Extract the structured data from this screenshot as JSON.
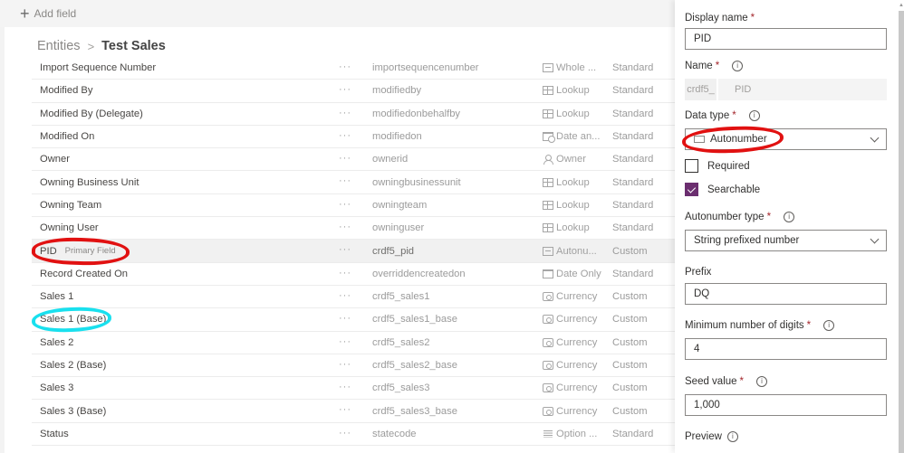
{
  "command_bar": {
    "add_field_icon": "plus-icon",
    "add_field_label": "Add field"
  },
  "breadcrumb": {
    "parent": "Entities",
    "separator": ">",
    "current": "Test Sales"
  },
  "fields_table": {
    "rows": [
      {
        "display_name": "Import Sequence Number",
        "tag": "",
        "schema_name": "importsequencenumber",
        "data_type": "Whole ...",
        "type_icon": "whole-number-icon",
        "customization": "Standard"
      },
      {
        "display_name": "Modified By",
        "tag": "",
        "schema_name": "modifiedby",
        "data_type": "Lookup",
        "type_icon": "lookup-icon",
        "customization": "Standard"
      },
      {
        "display_name": "Modified By (Delegate)",
        "tag": "",
        "schema_name": "modifiedonbehalfby",
        "data_type": "Lookup",
        "type_icon": "lookup-icon",
        "customization": "Standard"
      },
      {
        "display_name": "Modified On",
        "tag": "",
        "schema_name": "modifiedon",
        "data_type": "Date an...",
        "type_icon": "date-time-icon",
        "customization": "Standard"
      },
      {
        "display_name": "Owner",
        "tag": "",
        "schema_name": "ownerid",
        "data_type": "Owner",
        "type_icon": "owner-icon",
        "customization": "Standard"
      },
      {
        "display_name": "Owning Business Unit",
        "tag": "",
        "schema_name": "owningbusinessunit",
        "data_type": "Lookup",
        "type_icon": "lookup-icon",
        "customization": "Standard"
      },
      {
        "display_name": "Owning Team",
        "tag": "",
        "schema_name": "owningteam",
        "data_type": "Lookup",
        "type_icon": "lookup-icon",
        "customization": "Standard"
      },
      {
        "display_name": "Owning User",
        "tag": "",
        "schema_name": "owninguser",
        "data_type": "Lookup",
        "type_icon": "lookup-icon",
        "customization": "Standard"
      },
      {
        "display_name": "PID",
        "tag": "Primary Field",
        "schema_name": "crdf5_pid",
        "data_type": "Autonu...",
        "type_icon": "autonumber-icon",
        "customization": "Custom",
        "selected": true
      },
      {
        "display_name": "Record Created On",
        "tag": "",
        "schema_name": "overriddencreatedon",
        "data_type": "Date Only",
        "type_icon": "calendar-icon",
        "customization": "Standard"
      },
      {
        "display_name": "Sales 1",
        "tag": "",
        "schema_name": "crdf5_sales1",
        "data_type": "Currency",
        "type_icon": "currency-icon",
        "customization": "Custom"
      },
      {
        "display_name": "Sales 1 (Base)",
        "tag": "",
        "schema_name": "crdf5_sales1_base",
        "data_type": "Currency",
        "type_icon": "currency-icon",
        "customization": "Custom"
      },
      {
        "display_name": "Sales 2",
        "tag": "",
        "schema_name": "crdf5_sales2",
        "data_type": "Currency",
        "type_icon": "currency-icon",
        "customization": "Custom"
      },
      {
        "display_name": "Sales 2 (Base)",
        "tag": "",
        "schema_name": "crdf5_sales2_base",
        "data_type": "Currency",
        "type_icon": "currency-icon",
        "customization": "Custom"
      },
      {
        "display_name": "Sales 3",
        "tag": "",
        "schema_name": "crdf5_sales3",
        "data_type": "Currency",
        "type_icon": "currency-icon",
        "customization": "Custom"
      },
      {
        "display_name": "Sales 3 (Base)",
        "tag": "",
        "schema_name": "crdf5_sales3_base",
        "data_type": "Currency",
        "type_icon": "currency-icon",
        "customization": "Custom"
      },
      {
        "display_name": "Status",
        "tag": "",
        "schema_name": "statecode",
        "data_type": "Option ...",
        "type_icon": "option-set-icon",
        "customization": "Standard"
      }
    ],
    "more_glyph": "···"
  },
  "panel": {
    "display_name": {
      "label": "Display name",
      "required": "*",
      "value": "PID"
    },
    "name": {
      "label": "Name",
      "required": "*",
      "prefix": "crdf5_",
      "value": "PID",
      "info_icon": "i"
    },
    "data_type": {
      "label": "Data type",
      "required": "*",
      "value": "Autonumber",
      "info_icon": "i"
    },
    "required_checkbox": {
      "label": "Required",
      "checked": false
    },
    "searchable_checkbox": {
      "label": "Searchable",
      "checked": true
    },
    "autonumber_type": {
      "label": "Autonumber type",
      "required": "*",
      "value": "String prefixed number",
      "info_icon": "i"
    },
    "prefix": {
      "label": "Prefix",
      "value": "DQ"
    },
    "min_digits": {
      "label": "Minimum number of digits",
      "required": "*",
      "value": "4",
      "info_icon": "i"
    },
    "seed_value": {
      "label": "Seed value",
      "required": "*",
      "value": "1,000",
      "info_icon": "i"
    },
    "preview": {
      "label": "Preview",
      "info_icon": "i"
    }
  },
  "annotations": {
    "red": "#e11111",
    "cyan": "#19e0ee"
  },
  "colors": {
    "checkbox_accent": "#6b2e6f",
    "required_mark": "#a4262c"
  }
}
